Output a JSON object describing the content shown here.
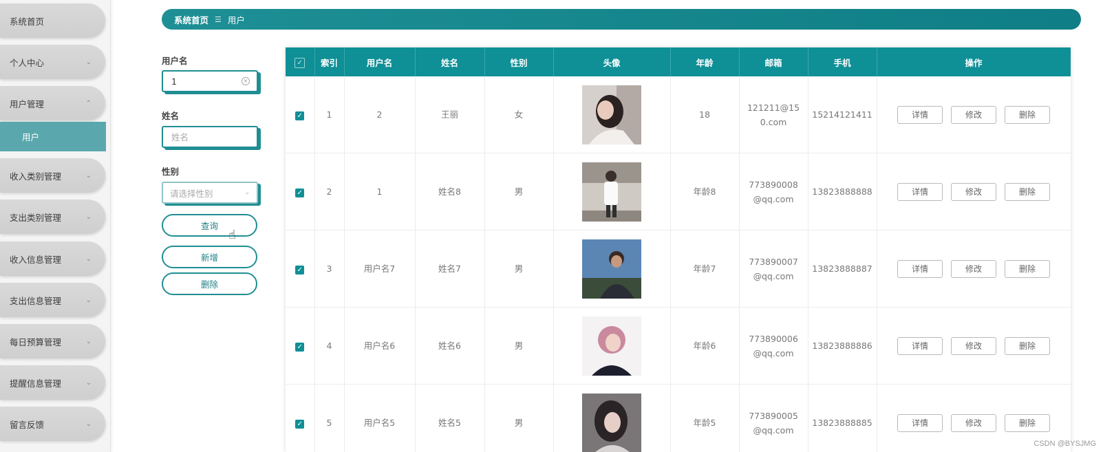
{
  "sidebar": {
    "items": [
      {
        "label": "系统首页",
        "chevron": ""
      },
      {
        "label": "个人中心",
        "chevron": "⌄"
      },
      {
        "label": "用户管理",
        "chevron": "⌃"
      },
      {
        "label": "收入类别管理",
        "chevron": "⌄"
      },
      {
        "label": "支出类别管理",
        "chevron": "⌄"
      },
      {
        "label": "收入信息管理",
        "chevron": "⌄"
      },
      {
        "label": "支出信息管理",
        "chevron": "⌄"
      },
      {
        "label": "每日预算管理",
        "chevron": "⌄"
      },
      {
        "label": "提醒信息管理",
        "chevron": "⌄"
      },
      {
        "label": "留言反馈",
        "chevron": "⌄"
      }
    ],
    "subitem": "用户"
  },
  "breadcrumb": {
    "home": "系统首页",
    "separator": "☰",
    "current": "用户"
  },
  "search": {
    "username_label": "用户名",
    "username_value": "1",
    "name_label": "姓名",
    "name_placeholder": "姓名",
    "gender_label": "性别",
    "gender_placeholder": "请选择性别",
    "query_button": "查询",
    "add_button": "新增",
    "delete_button": "删除"
  },
  "table": {
    "headers": {
      "check": "✓",
      "index": "索引",
      "username": "用户名",
      "name": "姓名",
      "gender": "性别",
      "avatar": "头像",
      "age": "年龄",
      "email": "邮箱",
      "phone": "手机",
      "actions": "操作"
    },
    "rows": [
      {
        "index": "1",
        "username": "2",
        "name": "王丽",
        "gender": "女",
        "age": "18",
        "email": "121211@150.com",
        "phone": "15214121411"
      },
      {
        "index": "2",
        "username": "1",
        "name": "姓名8",
        "gender": "男",
        "age": "年龄8",
        "email": "773890008@qq.com",
        "phone": "13823888888"
      },
      {
        "index": "3",
        "username": "用户名7",
        "name": "姓名7",
        "gender": "男",
        "age": "年龄7",
        "email": "773890007@qq.com",
        "phone": "13823888887"
      },
      {
        "index": "4",
        "username": "用户名6",
        "name": "姓名6",
        "gender": "男",
        "age": "年龄6",
        "email": "773890006@qq.com",
        "phone": "13823888886"
      },
      {
        "index": "5",
        "username": "用户名5",
        "name": "姓名5",
        "gender": "男",
        "age": "年龄5",
        "email": "773890005@qq.com",
        "phone": "13823888885"
      }
    ],
    "row_actions": {
      "detail": "详情",
      "edit": "修改",
      "delete": "删除"
    }
  },
  "watermark": "CSDN @BYSJMG",
  "colors": {
    "primary": "#0f8f96",
    "submenu_active": "#5aa8ad"
  }
}
